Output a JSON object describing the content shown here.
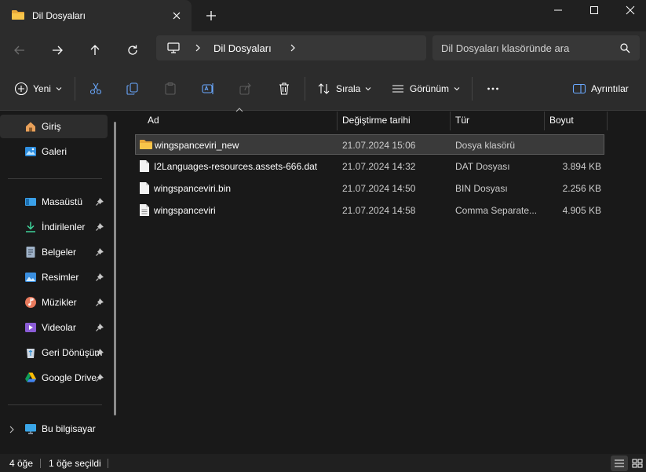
{
  "tab": {
    "title": "Dil Dosyaları"
  },
  "address": {
    "segment": "Dil Dosyaları"
  },
  "search": {
    "placeholder": "Dil Dosyaları klasöründe ara"
  },
  "commands": {
    "new": "Yeni",
    "sort": "Sırala",
    "view": "Görünüm",
    "details": "Ayrıntılar"
  },
  "sidebar": {
    "top": [
      {
        "label": "Giriş",
        "icon": "home-icon",
        "selected": true
      },
      {
        "label": "Galeri",
        "icon": "gallery-icon",
        "selected": false
      }
    ],
    "pinned": [
      {
        "label": "Masaüstü",
        "icon": "desktop-icon"
      },
      {
        "label": "İndirilenler",
        "icon": "downloads-icon"
      },
      {
        "label": "Belgeler",
        "icon": "documents-icon"
      },
      {
        "label": "Resimler",
        "icon": "pictures-icon"
      },
      {
        "label": "Müzikler",
        "icon": "music-icon"
      },
      {
        "label": "Videolar",
        "icon": "videos-icon"
      },
      {
        "label": "Geri Dönüşüm",
        "icon": "recycle-bin-icon"
      },
      {
        "label": "Google Drive",
        "icon": "google-drive-icon"
      }
    ],
    "this_pc": "Bu bilgisayar"
  },
  "columns": {
    "name": "Ad",
    "date": "Değiştirme tarihi",
    "type": "Tür",
    "size": "Boyut"
  },
  "files": [
    {
      "name": "wingspanceviri_new",
      "date": "21.07.2024 15:06",
      "type": "Dosya klasörü",
      "size": "",
      "icon": "folder-icon",
      "selected": true
    },
    {
      "name": "I2Languages-resources.assets-666.dat",
      "date": "21.07.2024 14:32",
      "type": "DAT Dosyası",
      "size": "3.894 KB",
      "icon": "file-icon",
      "selected": false
    },
    {
      "name": "wingspanceviri.bin",
      "date": "21.07.2024 14:50",
      "type": "BIN Dosyası",
      "size": "2.256 KB",
      "icon": "file-icon",
      "selected": false
    },
    {
      "name": "wingspanceviri",
      "date": "21.07.2024 14:58",
      "type": "Comma Separate...",
      "size": "4.905 KB",
      "icon": "csv-file-icon",
      "selected": false
    }
  ],
  "status": {
    "item_count": "4 öğe",
    "selected_count": "1 öğe seçildi"
  },
  "colors": {
    "accent": "#4cc2ff",
    "folder": "#f8c54a",
    "background": "#191919",
    "chrome": "#2c2c2c"
  }
}
